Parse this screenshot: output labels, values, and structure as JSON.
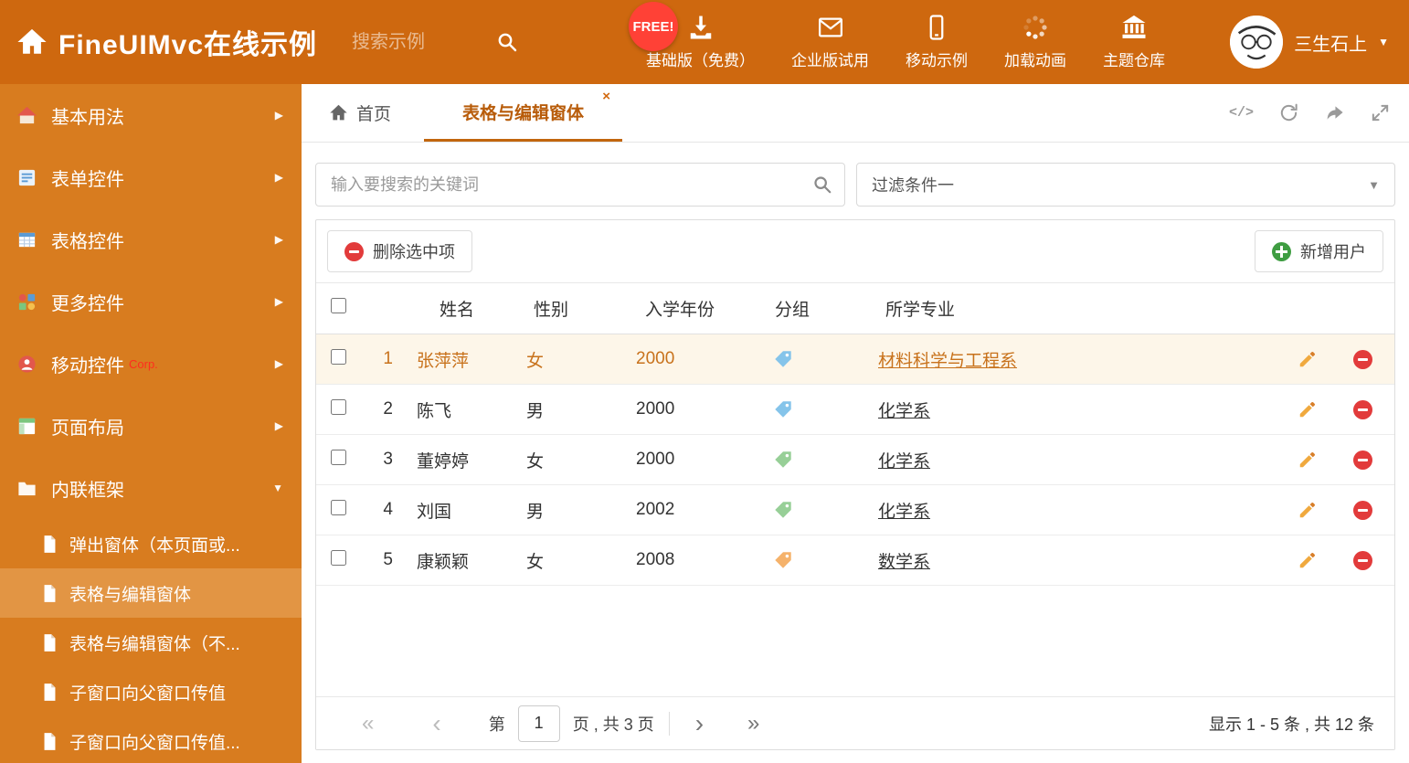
{
  "header": {
    "title": "FineUIMvc在线示例",
    "search_placeholder": "搜索示例",
    "free_badge": "FREE!",
    "nav_items": [
      {
        "label": "基础版（免费）",
        "icon": "download-icon"
      },
      {
        "label": "企业版试用",
        "icon": "envelope-icon"
      },
      {
        "label": "移动示例",
        "icon": "mobile-icon"
      },
      {
        "label": "加载动画",
        "icon": "spinner-icon"
      },
      {
        "label": "主题仓库",
        "icon": "bank-icon"
      }
    ],
    "user_name": "三生石上"
  },
  "sidebar": {
    "items": [
      {
        "label": "基本用法",
        "icon": "home-icon"
      },
      {
        "label": "表单控件",
        "icon": "form-icon"
      },
      {
        "label": "表格控件",
        "icon": "table-icon"
      },
      {
        "label": "更多控件",
        "icon": "controls-icon"
      },
      {
        "label": "移动控件",
        "icon": "mobile-icon",
        "badge": "Corp."
      },
      {
        "label": "页面布局",
        "icon": "layout-icon"
      },
      {
        "label": "内联框架",
        "icon": "folder-icon",
        "expanded": true
      }
    ],
    "subitems": [
      {
        "label": "弹出窗体（本页面或..."
      },
      {
        "label": "表格与编辑窗体",
        "active": true
      },
      {
        "label": "表格与编辑窗体（不..."
      },
      {
        "label": "子窗口向父窗口传值"
      },
      {
        "label": "子窗口向父窗口传值..."
      }
    ]
  },
  "tabs": {
    "home": "首页",
    "active": "表格与编辑窗体"
  },
  "filters": {
    "search_placeholder": "输入要搜索的关键词",
    "filter_selected": "过滤条件一"
  },
  "toolbar": {
    "delete_label": "删除选中项",
    "add_label": "新增用户"
  },
  "table": {
    "columns": [
      "姓名",
      "性别",
      "入学年份",
      "分组",
      "所学专业"
    ],
    "rows": [
      {
        "index": "1",
        "name": "张萍萍",
        "gender": "女",
        "year": "2000",
        "tag_color": "blue",
        "major": "材料科学与工程系",
        "selected": true
      },
      {
        "index": "2",
        "name": "陈飞",
        "gender": "男",
        "year": "2000",
        "tag_color": "blue",
        "major": "化学系",
        "selected": false
      },
      {
        "index": "3",
        "name": "董婷婷",
        "gender": "女",
        "year": "2000",
        "tag_color": "green",
        "major": "化学系",
        "selected": false
      },
      {
        "index": "4",
        "name": "刘国",
        "gender": "男",
        "year": "2002",
        "tag_color": "green",
        "major": "化学系",
        "selected": false
      },
      {
        "index": "5",
        "name": "康颖颖",
        "gender": "女",
        "year": "2008",
        "tag_color": "orange",
        "major": "数学系",
        "selected": false
      }
    ]
  },
  "pagination": {
    "label_page": "第",
    "current_page": "1",
    "label_total": "页 , 共 3 页",
    "summary": "显示 1 - 5 条 , 共 12 条"
  },
  "colors": {
    "header_bg": "#ce680f",
    "sidebar_bg": "#d87c1f",
    "sidebar_active_bg": "#e29544",
    "accent": "#c2660e",
    "selected_row_bg": "#fdf6e9",
    "tag_blue": "#85c4ea",
    "tag_green": "#97cf97",
    "tag_orange": "#f5b26b",
    "danger": "#e23b3b",
    "success": "#3f9d42",
    "free_badge_bg": "#ff4136"
  }
}
